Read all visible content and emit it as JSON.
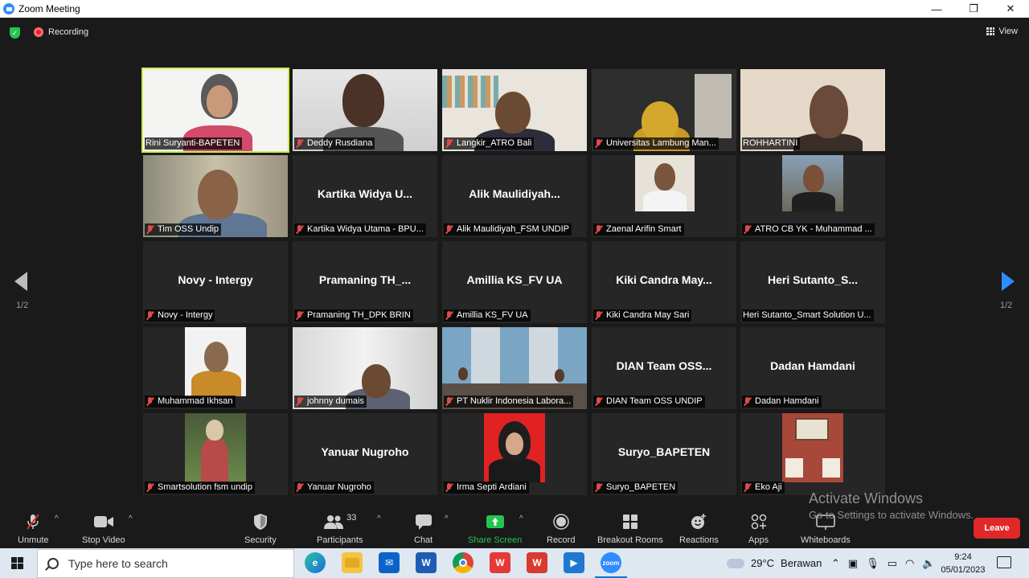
{
  "window": {
    "title": "Zoom Meeting",
    "controls": {
      "minimize": "—",
      "restore": "❐",
      "close": "✕"
    }
  },
  "status": {
    "recording_label": "Recording",
    "view_label": "View"
  },
  "pagination": {
    "left": "1/2",
    "right": "1/2"
  },
  "participants": [
    {
      "label": "Rini Suryanti-BAPETEN",
      "big_name": "",
      "muted": false,
      "video": "woman-hijab-white",
      "active": true
    },
    {
      "label": "Deddy Rusdiana",
      "big_name": "",
      "muted": true,
      "video": "man-white-wall"
    },
    {
      "label": "Langkir_ATRO Bali",
      "big_name": "",
      "muted": true,
      "video": "man-bookshelf"
    },
    {
      "label": "Universitas Lambung Man...",
      "big_name": "",
      "muted": true,
      "video": "woman-dark-room"
    },
    {
      "label": "ROHHARTINI",
      "big_name": "",
      "muted": false,
      "video": "woman-beige"
    },
    {
      "label": "Tim OSS Undip",
      "big_name": "",
      "muted": true,
      "video": "man-glasses-office"
    },
    {
      "label": "Kartika Widya Utama - BPU...",
      "big_name": "Kartika  Widya  U...",
      "muted": true,
      "video": ""
    },
    {
      "label": "Alik Maulidiyah_FSM UNDIP",
      "big_name": "Alik  Maulidiyah...",
      "muted": true,
      "video": ""
    },
    {
      "label": "Zaenal Arifin Smart",
      "big_name": "",
      "muted": true,
      "video": "photo-man-tie"
    },
    {
      "label": "ATRO CB YK - Muhammad ...",
      "big_name": "",
      "muted": true,
      "video": "photo-man-outdoor"
    },
    {
      "label": "Novy - Intergy",
      "big_name": "Novy - Intergy",
      "muted": true,
      "video": ""
    },
    {
      "label": "Pramaning TH_DPK BRIN",
      "big_name": "Pramaning  TH_...",
      "muted": true,
      "video": ""
    },
    {
      "label": "Amillia KS_FV UA",
      "big_name": "Amillia KS_FV UA",
      "muted": true,
      "video": ""
    },
    {
      "label": "Kiki Candra May Sari",
      "big_name": "Kiki  Candra  May...",
      "muted": true,
      "video": ""
    },
    {
      "label": "Heri Sutanto_Smart Solution U...",
      "big_name": "Heri  Sutanto_S...",
      "muted": false,
      "video": ""
    },
    {
      "label": "Muhammad Ikhsan",
      "big_name": "",
      "muted": true,
      "video": "photo-man-batik"
    },
    {
      "label": "johnny dumais",
      "big_name": "",
      "muted": true,
      "video": "man-room"
    },
    {
      "label": "PT Nuklir Indonesia Labora...",
      "big_name": "",
      "muted": true,
      "video": "meeting-room"
    },
    {
      "label": "DIAN Team OSS UNDIP",
      "big_name": "DIAN  Team  OSS...",
      "muted": true,
      "video": ""
    },
    {
      "label": "Dadan Hamdani",
      "big_name": "Dadan Hamdani",
      "muted": true,
      "video": ""
    },
    {
      "label": "Smartsolution fsm undip",
      "big_name": "",
      "muted": true,
      "video": "photo-woman-garden"
    },
    {
      "label": "Yanuar Nugroho",
      "big_name": "Yanuar Nugroho",
      "muted": true,
      "video": ""
    },
    {
      "label": "Irma Septi Ardiani",
      "big_name": "",
      "muted": true,
      "video": "photo-woman-red"
    },
    {
      "label": "Suryo_BAPETEN",
      "big_name": "Suryo_BAPETEN",
      "muted": true,
      "video": ""
    },
    {
      "label": "Eko Aji",
      "big_name": "",
      "muted": true,
      "video": "photo-room-red"
    }
  ],
  "toolbar": {
    "unmute": "Unmute",
    "stop_video": "Stop Video",
    "security": "Security",
    "participants": "Participants",
    "participants_count": "33",
    "chat": "Chat",
    "share_screen": "Share Screen",
    "record": "Record",
    "breakout_rooms": "Breakout Rooms",
    "reactions": "Reactions",
    "apps": "Apps",
    "whiteboards": "Whiteboards",
    "leave": "Leave"
  },
  "watermark": {
    "title": "Activate Windows",
    "subtitle": "Go to Settings to activate Windows."
  },
  "taskbar": {
    "search_placeholder": "Type here to search",
    "apps": [
      "edge-icon",
      "file-explorer-icon",
      "mail-icon",
      "word-icon",
      "chrome-icon",
      "wps-icon",
      "wps-office-icon",
      "video-player-icon",
      "zoom-icon"
    ],
    "weather_temp": "29°C",
    "weather_text": "Berawan",
    "time": "9:24",
    "date": "05/01/2023"
  },
  "colors": {
    "accent": "#2d8cff",
    "active_speaker": "#c8f04a",
    "share": "#24c451",
    "leave": "#e02828"
  }
}
